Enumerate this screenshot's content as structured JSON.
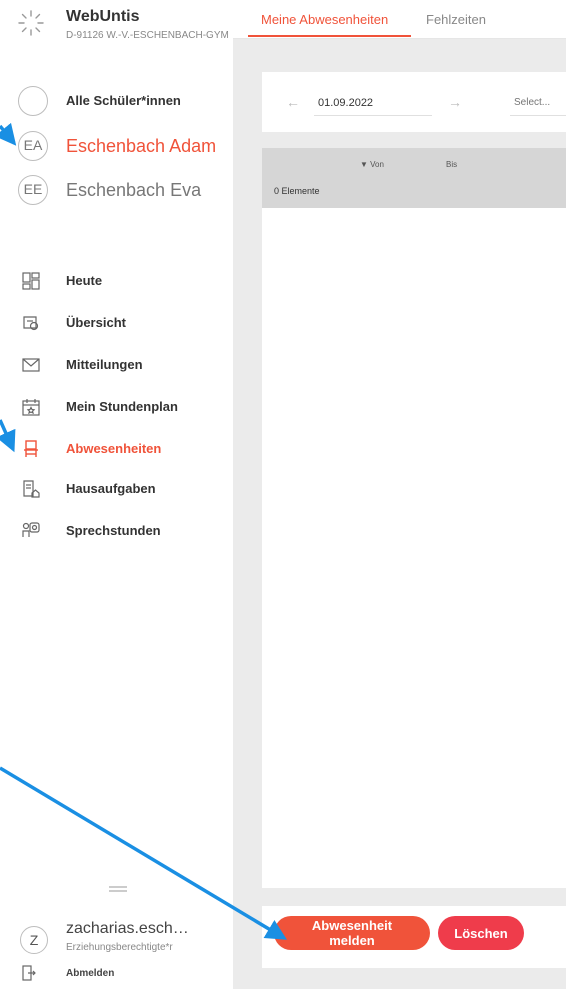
{
  "brand": {
    "title": "WebUntis",
    "subtitle": "D-91126 W.-V.-ESCHENBACH-GYM"
  },
  "students": [
    {
      "label": "Alle Schüler*innen",
      "initials": ""
    },
    {
      "label": "Eschenbach Adam",
      "initials": "EA",
      "active": true
    },
    {
      "label": "Eschenbach Eva",
      "initials": "EE"
    }
  ],
  "nav": [
    {
      "label": "Heute",
      "icon": "dashboard-icon"
    },
    {
      "label": "Übersicht",
      "icon": "overview-icon"
    },
    {
      "label": "Mitteilungen",
      "icon": "mail-icon"
    },
    {
      "label": "Mein Stundenplan",
      "icon": "calendar-icon"
    },
    {
      "label": "Abwesenheiten",
      "icon": "chair-icon",
      "active": true
    },
    {
      "label": "Hausaufgaben",
      "icon": "homework-icon"
    },
    {
      "label": "Sprechstunden",
      "icon": "consultation-icon"
    }
  ],
  "user": {
    "initial": "Z",
    "name": "zacharias.esch…",
    "role": "Erziehungsberechtigte*r",
    "logout": "Abmelden"
  },
  "tabs": [
    {
      "label": "Meine Abwesenheiten",
      "active": true
    },
    {
      "label": "Fehlzeiten"
    }
  ],
  "filter": {
    "prev_arrow": "←",
    "date": "01.09.2022",
    "next_arrow": "→",
    "select_placeholder": "Select..."
  },
  "table": {
    "col_from": "Von",
    "col_to": "Bis",
    "count": "0 Elemente"
  },
  "actions": {
    "report": "Abwesenheit melden",
    "delete": "Löschen"
  },
  "colors": {
    "accent": "#f0533a",
    "delete": "#ef3c4b",
    "annotation": "#1a8fe3"
  }
}
